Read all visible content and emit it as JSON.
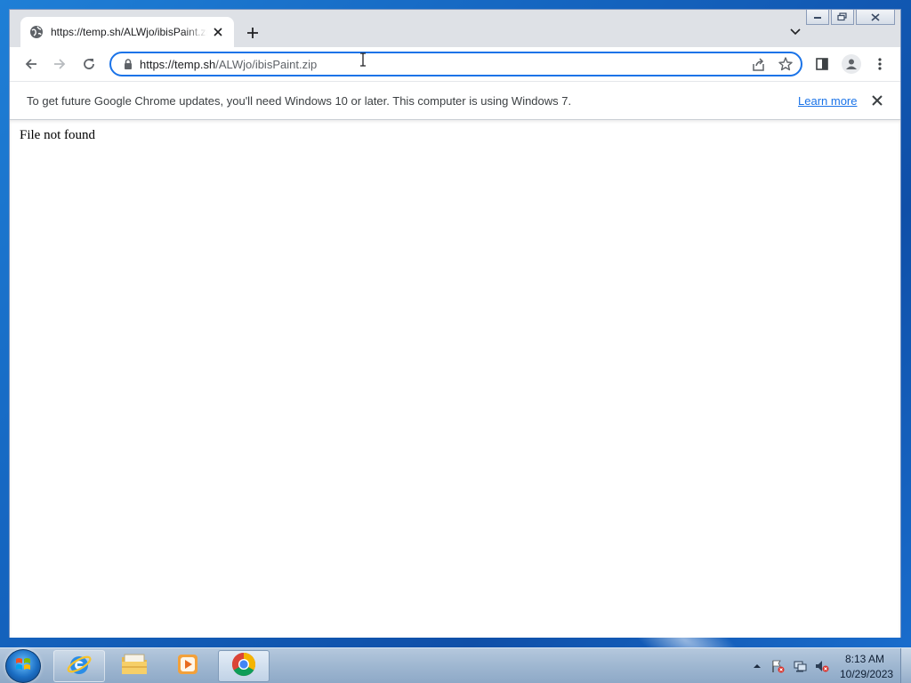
{
  "browser": {
    "tab": {
      "title": "https://temp.sh/ALWjo/ibisPaint.zip"
    },
    "address_bar": {
      "scheme_host": "https://temp.sh",
      "path": "/ALWjo/ibisPaint.zip"
    },
    "infobar": {
      "message": "To get future Google Chrome updates, you'll need Windows 10 or later. This computer is using Windows 7.",
      "link_label": "Learn more"
    },
    "page": {
      "body_text": "File not found"
    }
  },
  "taskbar": {
    "pinned_apps": [
      "internet-explorer",
      "file-explorer",
      "media-player",
      "google-chrome"
    ],
    "active_app": "google-chrome",
    "clock": {
      "time": "8:13 AM",
      "date": "10/29/2023"
    }
  },
  "colors": {
    "accent": "#1a73e8",
    "desktop": "#1565c0",
    "tab_strip": "#dee1e6"
  }
}
